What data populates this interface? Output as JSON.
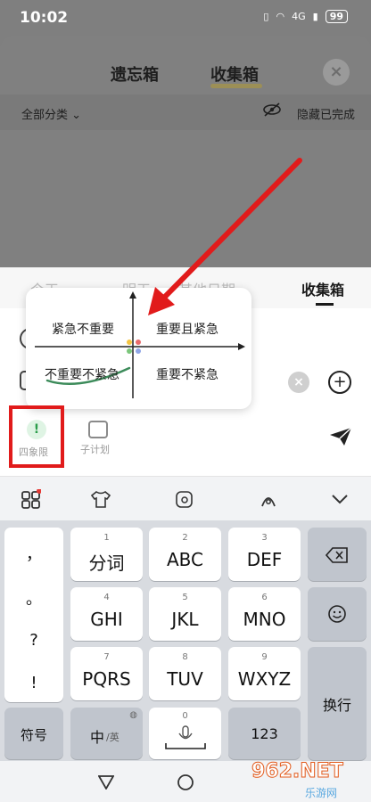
{
  "status": {
    "time": "10:02",
    "network": "4G",
    "battery": "99"
  },
  "header": {
    "tabs": [
      "遗忘箱",
      "收集箱"
    ],
    "filter_label": "全部分类",
    "hide_done_label": "隐藏已完成"
  },
  "sheet": {
    "tabs": [
      "今天",
      "明天",
      "其他日期",
      "收集箱"
    ]
  },
  "quadrant": {
    "top_left": "紧急不重要",
    "top_right": "重要且紧急",
    "bottom_left": "不重要不紧急",
    "bottom_right": "重要不紧急"
  },
  "toolbar": {
    "quadrant_label": "四象限",
    "subplan_label": "子计划"
  },
  "keyboard": {
    "left_col": [
      "，",
      "。",
      "?",
      "!"
    ],
    "rows": [
      [
        {
          "num": "1",
          "main": "分词"
        },
        {
          "num": "2",
          "main": "ABC"
        },
        {
          "num": "3",
          "main": "DEF"
        }
      ],
      [
        {
          "num": "4",
          "main": "GHI"
        },
        {
          "num": "5",
          "main": "JKL"
        },
        {
          "num": "6",
          "main": "MNO"
        }
      ],
      [
        {
          "num": "7",
          "main": "PQRS"
        },
        {
          "num": "8",
          "main": "TUV"
        },
        {
          "num": "9",
          "main": "WXYZ"
        }
      ]
    ],
    "symbols_label": "符号",
    "lang_label": "中",
    "lang_alt": "/英",
    "space_num": "0",
    "num_label": "123",
    "newline_label": "换行"
  },
  "watermark": {
    "text": "962.NET",
    "sub": "乐游网"
  },
  "colors": {
    "highlight": "#e11b1b",
    "accent_green": "#2a9d4a"
  }
}
